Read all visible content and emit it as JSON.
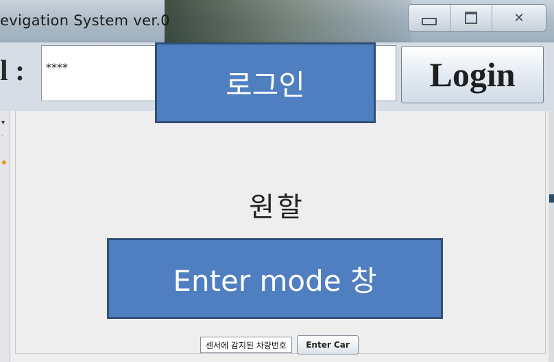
{
  "window": {
    "title": "evigation System ver.0",
    "controls": {
      "close_glyph": "✕"
    }
  },
  "login": {
    "label": "l :",
    "password_value": "****",
    "button_label": "Login"
  },
  "main": {
    "status_text": "원할",
    "sensor_field_value": "센서에 감지된 차량번호",
    "enter_car_label": "Enter Car"
  },
  "annotations": {
    "login_callout": "로그인",
    "enter_mode_callout": "Enter mode 창"
  },
  "colors": {
    "callout_fill": "#4f7fc0",
    "callout_border": "#2f4f78",
    "panel_bg": "#eeeeee"
  }
}
